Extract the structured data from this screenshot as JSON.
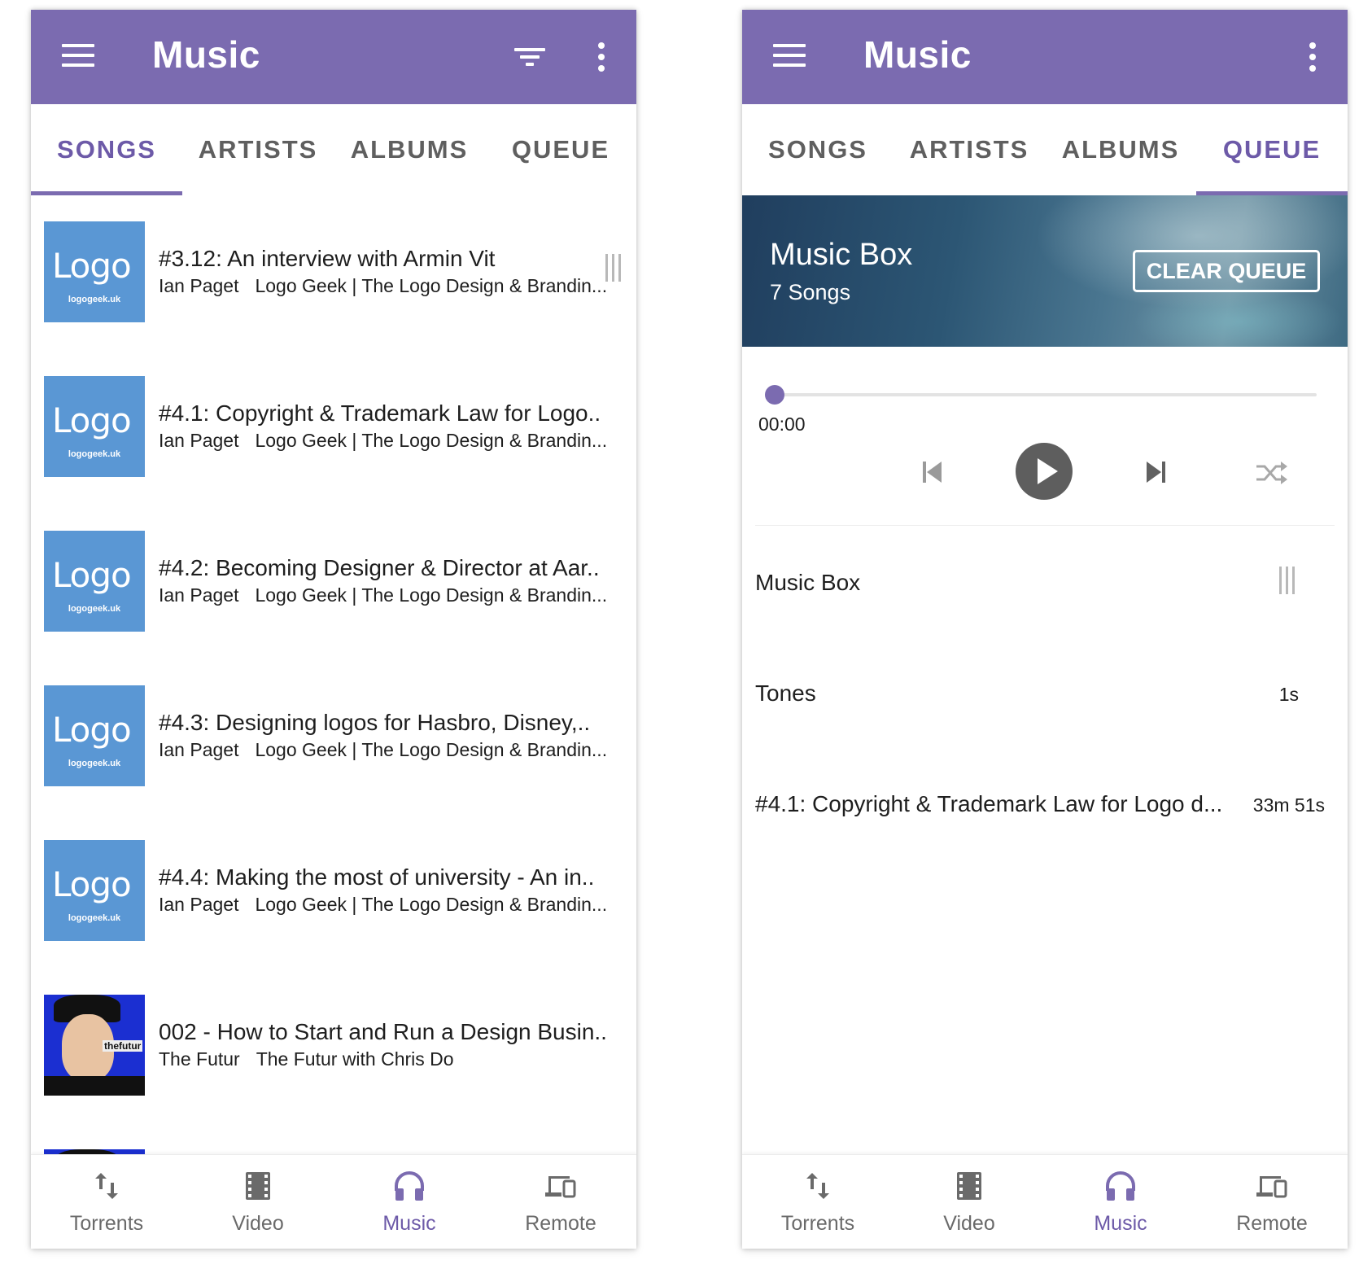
{
  "left": {
    "app_title": "Music",
    "tabs": [
      {
        "label": "SONGS"
      },
      {
        "label": "ARTISTS"
      },
      {
        "label": "ALBUMS"
      },
      {
        "label": "QUEUE"
      }
    ],
    "songs": [
      {
        "title": "#3.12: An interview with Armin Vit",
        "artist": "Ian Paget",
        "album": "Logo Geek | The Logo Design & Brandin...",
        "art": "Logo",
        "art_sub": "logogeek.uk"
      },
      {
        "title": "#4.1: Copyright & Trademark Law for Logo..",
        "artist": "Ian Paget",
        "album": "Logo Geek | The Logo Design & Brandin...",
        "art": "Logo",
        "art_sub": "logogeek.uk"
      },
      {
        "title": "#4.2: Becoming Designer & Director at Aar..",
        "artist": "Ian Paget",
        "album": "Logo Geek | The Logo Design & Brandin...",
        "art": "Logo",
        "art_sub": "logogeek.uk"
      },
      {
        "title": "#4.3: Designing logos for Hasbro, Disney,..",
        "artist": "Ian Paget",
        "album": "Logo Geek | The Logo Design & Brandin...",
        "art": "Logo",
        "art_sub": "logogeek.uk"
      },
      {
        "title": "#4.4: Making the most of university - An in..",
        "artist": "Ian Paget",
        "album": "Logo Geek | The Logo Design & Brandin...",
        "art": "Logo",
        "art_sub": "logogeek.uk"
      },
      {
        "title": "002 - How to Start and Run a Design Busin..",
        "artist": "The Futur",
        "album": "The Futur with Chris Do",
        "art_sub": "thefutur"
      }
    ],
    "bottom_nav": [
      {
        "label": "Torrents",
        "icon": "swap-vertical-icon"
      },
      {
        "label": "Video",
        "icon": "film-strip-icon"
      },
      {
        "label": "Music",
        "icon": "headphones-icon"
      },
      {
        "label": "Remote",
        "icon": "devices-icon"
      }
    ]
  },
  "right": {
    "app_title": "Music",
    "tabs": [
      {
        "label": "SONGS"
      },
      {
        "label": "ARTISTS"
      },
      {
        "label": "ALBUMS"
      },
      {
        "label": "QUEUE"
      }
    ],
    "queue_header": {
      "title": "Music Box",
      "count": "7 Songs",
      "clear_label": "CLEAR QUEUE"
    },
    "player": {
      "time": "00:00",
      "progress": 0
    },
    "queue": [
      {
        "title": "Music Box",
        "duration": ""
      },
      {
        "title": "Tones",
        "duration": "1s"
      },
      {
        "title": "#4.1: Copyright & Trademark Law for Logo d...",
        "duration": "33m 51s"
      }
    ],
    "bottom_nav": [
      {
        "label": "Torrents",
        "icon": "swap-vertical-icon"
      },
      {
        "label": "Video",
        "icon": "film-strip-icon"
      },
      {
        "label": "Music",
        "icon": "headphones-icon"
      },
      {
        "label": "Remote",
        "icon": "devices-icon"
      }
    ]
  },
  "colors": {
    "primary": "#7b6bb0",
    "active_tab": "#6d5aa8",
    "inactive_text": "#5f5f5f",
    "logo_art_bg": "#5a97d4"
  }
}
